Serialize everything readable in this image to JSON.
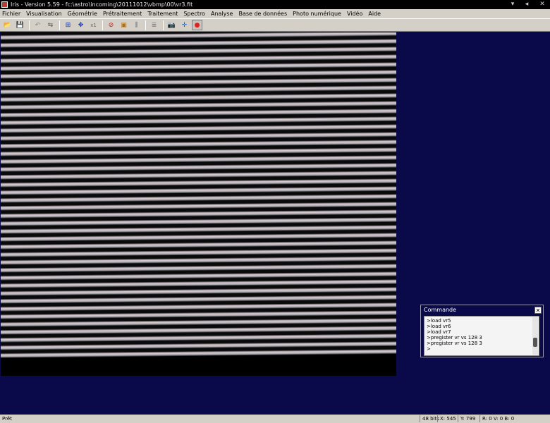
{
  "window": {
    "title": "Iris - Version 5.59 - fc:\\astro\\incoming\\20111012\\vbmp\\00\\vr3.fit",
    "controls": {
      "minimize": "▾",
      "restore": "◂",
      "close": "✕"
    }
  },
  "menu": [
    "Fichier",
    "Visualisation",
    "Géométrie",
    "Prétraitement",
    "Traitement",
    "Spectro",
    "Analyse",
    "Base de données",
    "Photo numérique",
    "Vidéo",
    "Aide"
  ],
  "toolbar": [
    {
      "name": "open-folder-icon",
      "glyph": "📂"
    },
    {
      "name": "save-icon",
      "glyph": "💾"
    },
    {
      "name": "undo-icon",
      "glyph": "↶"
    },
    {
      "name": "threshold-icon",
      "glyph": "⇆"
    },
    {
      "name": "grid-icon",
      "glyph": "⊞"
    },
    {
      "name": "zoom-in-icon",
      "glyph": "✥"
    },
    {
      "name": "zoom-x1-icon",
      "glyph": "x1"
    },
    {
      "name": "no-icon",
      "glyph": "⊘"
    },
    {
      "name": "crop-icon",
      "glyph": "▣"
    },
    {
      "name": "split-icon",
      "glyph": "⫼"
    },
    {
      "name": "text-icon",
      "glyph": "≣"
    },
    {
      "name": "camera-icon",
      "glyph": "📷"
    },
    {
      "name": "move-icon",
      "glyph": "✛"
    },
    {
      "name": "record-icon",
      "glyph": "●"
    }
  ],
  "colors": {
    "workspace_bg": "#0a0a4a",
    "record": "#e02020"
  },
  "command_window": {
    "title": "Commande",
    "close_label": "✕",
    "lines": [
      ">load vr5",
      ">load vr6",
      ">load vr7",
      ">pregister vr vs 128 3",
      ">pregister vr vs 128 3",
      ">"
    ]
  },
  "statusbar": {
    "status": "Prêt",
    "bits": "48 bits",
    "x": "X: 545",
    "y": "Y: 799",
    "rvb": "R: 0  V: 0  B: 0"
  }
}
